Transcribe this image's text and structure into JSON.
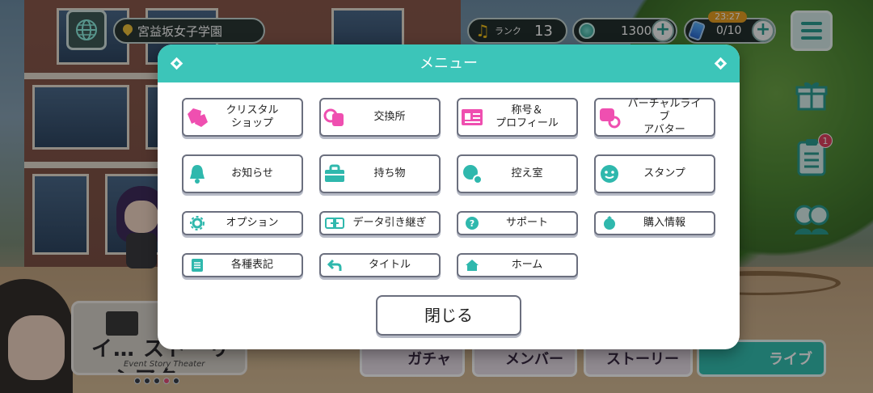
{
  "header": {
    "location": "宮益坂女子学園",
    "rank_label": "ランク",
    "rank_value": "13",
    "crystal_count": "1300",
    "stamina": "0/10",
    "stamina_timer": "23:27",
    "notification_badge": "1"
  },
  "menu": {
    "title": "メニュー",
    "items": [
      {
        "label": "クリスタル\nショップ",
        "icon": "crystal-shop-icon"
      },
      {
        "label": "交換所",
        "icon": "exchange-icon"
      },
      {
        "label": "称号＆\nプロフィール",
        "icon": "profile-card-icon"
      },
      {
        "label": "バーチャルライブ\nアバター",
        "icon": "avatar-icon"
      },
      {
        "label": "お知らせ",
        "icon": "bell-icon"
      },
      {
        "label": "持ち物",
        "icon": "bag-icon"
      },
      {
        "label": "控え室",
        "icon": "room-icon"
      },
      {
        "label": "スタンプ",
        "icon": "smiley-icon"
      },
      {
        "label": "オプション",
        "icon": "gear-icon"
      },
      {
        "label": "データ引き継ぎ",
        "icon": "data-transfer-icon"
      },
      {
        "label": "サポート",
        "icon": "question-icon"
      },
      {
        "label": "購入情報",
        "icon": "purchase-icon"
      },
      {
        "label": "各種表記",
        "icon": "list-icon"
      },
      {
        "label": "タイトル",
        "icon": "back-arrow-icon"
      },
      {
        "label": "ホーム",
        "icon": "home-icon"
      }
    ],
    "close_label": "閉じる"
  },
  "banner": {
    "title": "イ… ストーリーシアター",
    "subtitle": "Event Story Theater"
  },
  "bottom_nav": {
    "gacha": "ガチャ",
    "member": "メンバー",
    "story": "ストーリー",
    "live": "ライブ"
  },
  "colors": {
    "accent": "#3cc5b9",
    "icon_pink": "#ef4fb0",
    "icon_teal": "#2fb8ad"
  }
}
